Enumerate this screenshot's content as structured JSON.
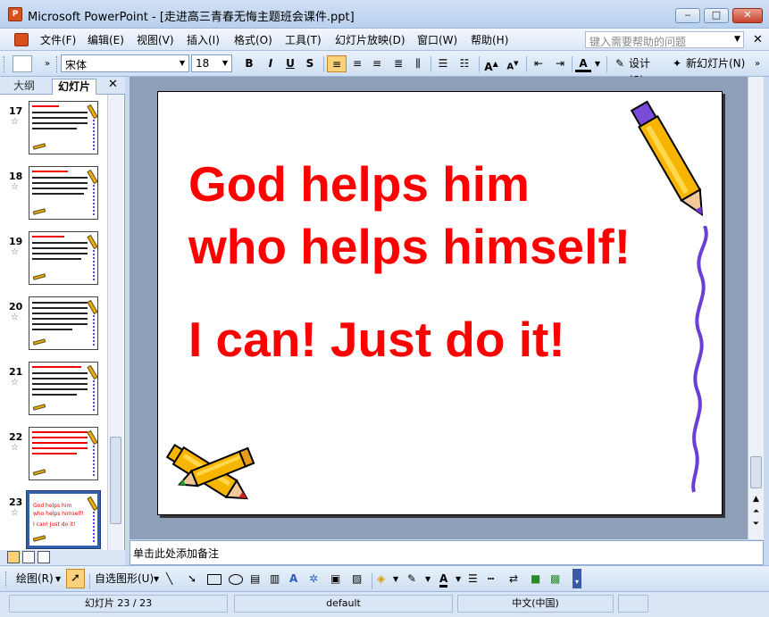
{
  "window": {
    "title": "Microsoft PowerPoint - [走进高三青春无悔主题班会课件.ppt]",
    "minimize": "‒",
    "maximize": "□",
    "close": "✕"
  },
  "menubar": {
    "items": [
      "文件(F)",
      "编辑(E)",
      "视图(V)",
      "插入(I)",
      "格式(O)",
      "工具(T)",
      "幻灯片放映(D)",
      "窗口(W)",
      "帮助(H)"
    ],
    "help_placeholder": "键入需要帮助的问题"
  },
  "toolbar": {
    "font": "宋体",
    "size": "18",
    "bold": "B",
    "italic": "I",
    "underline": "U",
    "shadow": "S",
    "font_color": "A",
    "design_label": "设计(S)",
    "new_slide_label": "新幻灯片(N)"
  },
  "leftpane": {
    "tab_outline": "大纲",
    "tab_slides": "幻灯片",
    "close": "✕",
    "slides": [
      {
        "num": "17"
      },
      {
        "num": "18"
      },
      {
        "num": "19"
      },
      {
        "num": "20"
      },
      {
        "num": "21"
      },
      {
        "num": "22"
      },
      {
        "num": "23"
      }
    ],
    "current_slide_lines": [
      "God helps him",
      "who helps himself!",
      "I can!  Just do it!"
    ]
  },
  "slide": {
    "line1": "God helps him",
    "line2": "who helps himself!",
    "line3": "I can!  Just do it!",
    "text_color": "#ff0000"
  },
  "notes": {
    "placeholder": "单击此处添加备注"
  },
  "drawbar": {
    "draw_label": "绘图(R)",
    "autoshapes_label": "自选图形(U)"
  },
  "status": {
    "slide": "幻灯片 23 / 23",
    "design": "default",
    "language": "中文(中国)"
  }
}
